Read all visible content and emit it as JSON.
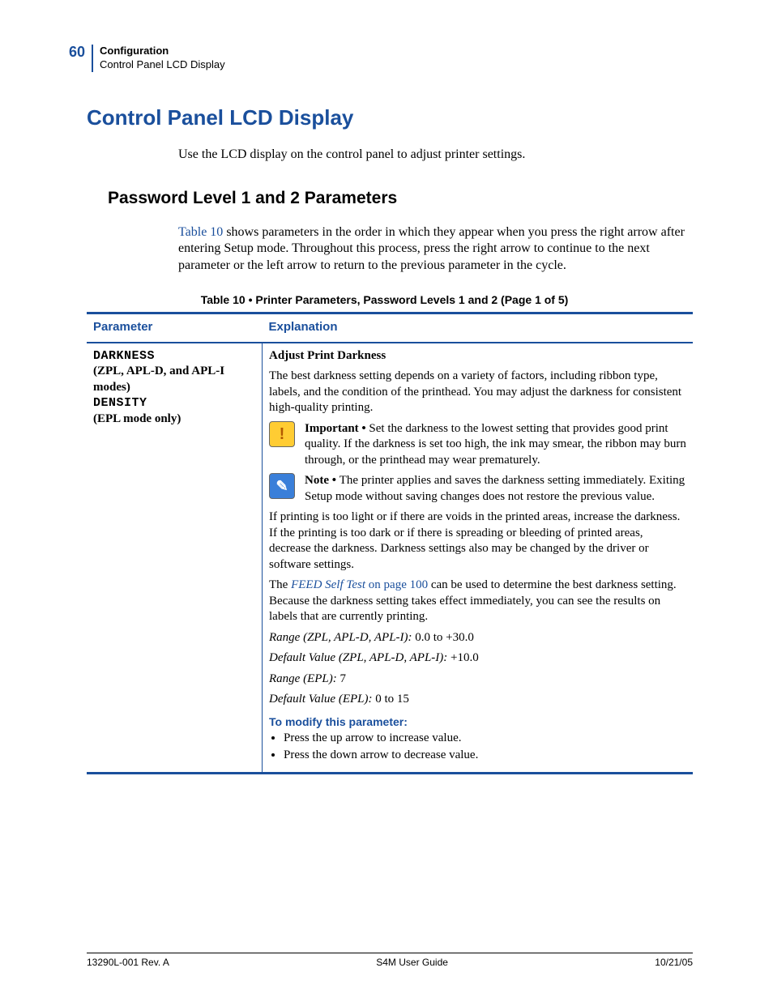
{
  "header": {
    "page_number": "60",
    "chapter": "Configuration",
    "section": "Control Panel LCD Display"
  },
  "main": {
    "title": "Control Panel LCD Display",
    "intro": "Use the LCD display on the control panel to adjust printer settings.",
    "subtitle": "Password Level 1 and 2 Parameters",
    "body_link": "Table 10",
    "body_rest": " shows parameters in the order in which they appear when you press the right arrow after entering Setup mode. Throughout this process, press the right arrow to continue to the next parameter or the left arrow to return to the previous parameter in the cycle."
  },
  "table": {
    "caption": "Table 10 • Printer Parameters, Password Levels 1 and 2 (Page 1 of 5)",
    "headers": {
      "param": "Parameter",
      "explanation": "Explanation"
    },
    "row": {
      "param": {
        "lcd1": "DARKNESS",
        "sub1": "(ZPL, APL-D, and APL-I modes)",
        "lcd2": "DENSITY",
        "sub2": "(EPL mode only)"
      },
      "exp": {
        "title": "Adjust Print Darkness",
        "p1": "The best darkness setting depends on a variety of factors, including ribbon type, labels, and the condition of the printhead. You may adjust the darkness for consistent high-quality printing.",
        "important_label": "Important • ",
        "important_text": "Set the darkness to the lowest setting that provides good print quality. If the darkness is set too high, the ink may smear, the ribbon may burn through, or the printhead may wear prematurely.",
        "note_label": "Note • ",
        "note_text": "The printer applies and saves the darkness setting immediately. Exiting Setup mode without saving changes does not restore the previous value.",
        "p2": "If printing is too light or if there are voids in the printed areas, increase the darkness. If the printing is too dark or if there is spreading or bleeding of printed areas, decrease the darkness. Darkness settings also may be changed by the driver or software settings.",
        "p3a": "The ",
        "p3link1": "FEED Self Test",
        "p3link2": " on page 100",
        "p3b": " can be used to determine the best darkness setting. Because the darkness setting takes effect immediately, you can see the results on labels that are currently printing.",
        "range1_label": "Range (ZPL, APL-D, APL-I):",
        "range1_val": " 0.0 to +30.0",
        "def1_label": "Default Value (ZPL, APL-D, APL-I):",
        "def1_val": " +10.0",
        "range2_label": "Range (EPL):",
        "range2_val": " 7",
        "def2_label": "Default Value (EPL):",
        "def2_val": " 0 to 15",
        "modify": "To modify this parameter:",
        "li1": "Press the up arrow to increase value.",
        "li2": "Press the down arrow to decrease value."
      }
    }
  },
  "footer": {
    "left": "13290L-001 Rev. A",
    "center": "S4M User Guide",
    "right": "10/21/05"
  }
}
